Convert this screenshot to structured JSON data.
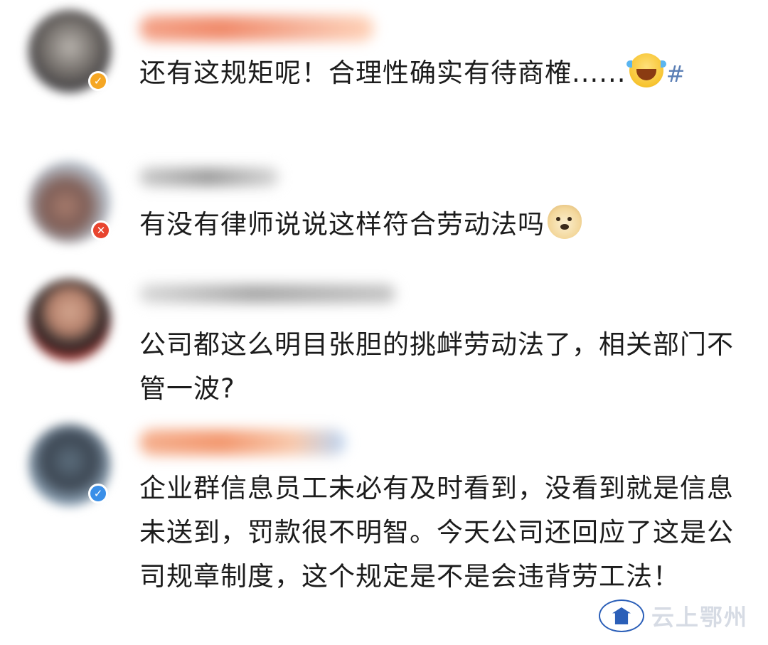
{
  "comments": [
    {
      "text": "还有这规矩呢！合理性确实有待商榷......",
      "emoji": "laughing-crying-emoji",
      "suffix": "#",
      "badge": "✓",
      "badge_color": "#f5a623"
    },
    {
      "text": "有没有律师说说这样符合劳动法吗",
      "emoji": "doge-emoji",
      "badge": "✕",
      "badge_color": "#e8442e"
    },
    {
      "text": "公司都这么明目张胆的挑衅劳动法了，相关部门不管一波?"
    },
    {
      "text": "企业群信息员工未必有及时看到，没看到就是信息未送到，罚款很不明智。今天公司还回应了这是公司规章制度，这个规定是不是会违背劳工法！",
      "badge": "✓",
      "badge_color": "#3a8fe8"
    }
  ],
  "watermark": {
    "text": "云上鄂州"
  }
}
